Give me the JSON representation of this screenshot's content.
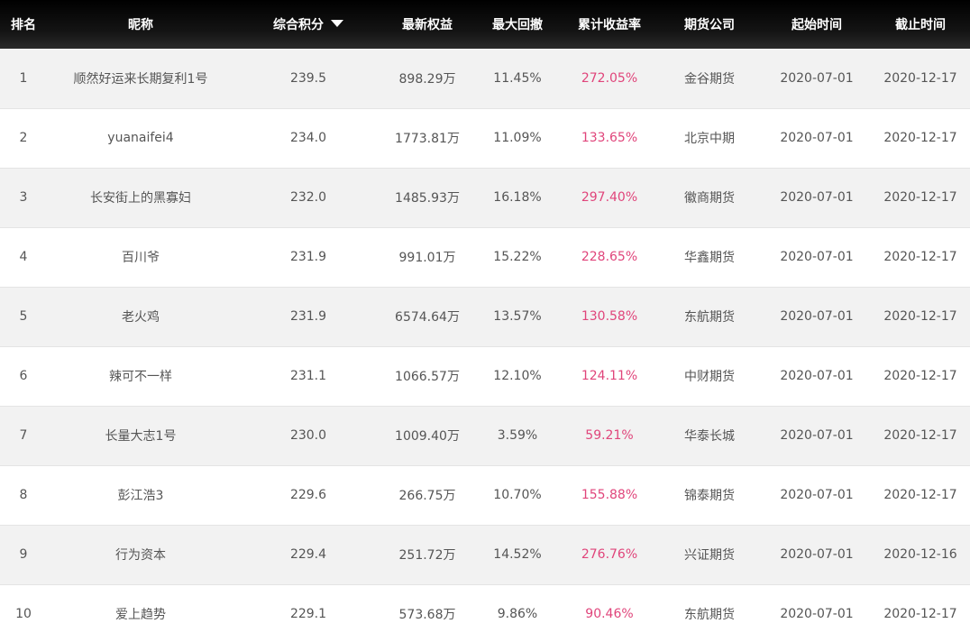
{
  "columns": {
    "rank": "排名",
    "nickname": "昵称",
    "score": "综合积分",
    "equity": "最新权益",
    "drawdown": "最大回撤",
    "return": "累计收益率",
    "company": "期货公司",
    "start": "起始时间",
    "end": "截止时间"
  },
  "sort": {
    "column": "score",
    "direction": "desc",
    "icon": "caret-down-icon"
  },
  "colors": {
    "header_bg": "#000000",
    "return_text": "#e0457b",
    "stripe": "#f2f2f2",
    "text": "#555555"
  },
  "rows": [
    {
      "rank": "1",
      "nickname": "顺然好运来长期复利1号",
      "score": "239.5",
      "equity": "898.29万",
      "drawdown": "11.45%",
      "return": "272.05%",
      "company": "金谷期货",
      "start": "2020-07-01",
      "end": "2020-12-17"
    },
    {
      "rank": "2",
      "nickname": "yuanaifei4",
      "score": "234.0",
      "equity": "1773.81万",
      "drawdown": "11.09%",
      "return": "133.65%",
      "company": "北京中期",
      "start": "2020-07-01",
      "end": "2020-12-17"
    },
    {
      "rank": "3",
      "nickname": "长安街上的黑寡妇",
      "score": "232.0",
      "equity": "1485.93万",
      "drawdown": "16.18%",
      "return": "297.40%",
      "company": "徽商期货",
      "start": "2020-07-01",
      "end": "2020-12-17"
    },
    {
      "rank": "4",
      "nickname": "百川爷",
      "score": "231.9",
      "equity": "991.01万",
      "drawdown": "15.22%",
      "return": "228.65%",
      "company": "华鑫期货",
      "start": "2020-07-01",
      "end": "2020-12-17"
    },
    {
      "rank": "5",
      "nickname": "老火鸡",
      "score": "231.9",
      "equity": "6574.64万",
      "drawdown": "13.57%",
      "return": "130.58%",
      "company": "东航期货",
      "start": "2020-07-01",
      "end": "2020-12-17"
    },
    {
      "rank": "6",
      "nickname": "辣可不一样",
      "score": "231.1",
      "equity": "1066.57万",
      "drawdown": "12.10%",
      "return": "124.11%",
      "company": "中财期货",
      "start": "2020-07-01",
      "end": "2020-12-17"
    },
    {
      "rank": "7",
      "nickname": "长量大志1号",
      "score": "230.0",
      "equity": "1009.40万",
      "drawdown": "3.59%",
      "return": "59.21%",
      "company": "华泰长城",
      "start": "2020-07-01",
      "end": "2020-12-17"
    },
    {
      "rank": "8",
      "nickname": "彭江浩3",
      "score": "229.6",
      "equity": "266.75万",
      "drawdown": "10.70%",
      "return": "155.88%",
      "company": "锦泰期货",
      "start": "2020-07-01",
      "end": "2020-12-17"
    },
    {
      "rank": "9",
      "nickname": "行为资本",
      "score": "229.4",
      "equity": "251.72万",
      "drawdown": "14.52%",
      "return": "276.76%",
      "company": "兴证期货",
      "start": "2020-07-01",
      "end": "2020-12-16"
    },
    {
      "rank": "10",
      "nickname": "爱上趋势",
      "score": "229.1",
      "equity": "573.68万",
      "drawdown": "9.86%",
      "return": "90.46%",
      "company": "东航期货",
      "start": "2020-07-01",
      "end": "2020-12-17"
    }
  ]
}
